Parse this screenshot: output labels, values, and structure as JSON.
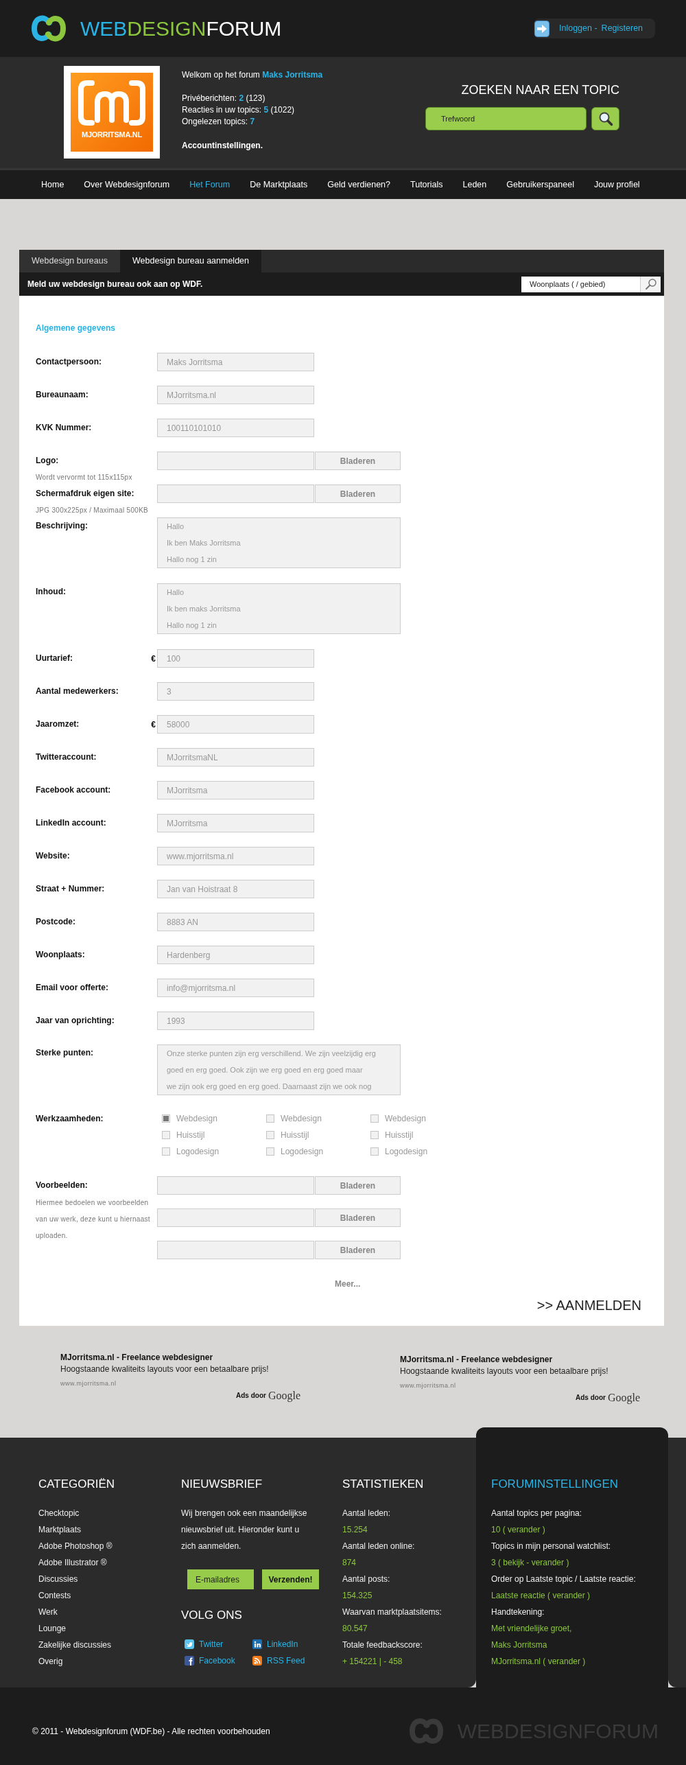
{
  "header": {
    "logo_parts": [
      "WEB",
      "DESIGN",
      "FORUM"
    ],
    "login_link": "Inloggen -",
    "register_link": "Registeren"
  },
  "user_panel": {
    "avatar_caption": "MJORRITSMA.NL",
    "welcome": "Welkom op het forum **Maks Jorritsma**",
    "stats": [
      "Privéberichten: **2** (123)",
      "Reacties in uw topics: **5** (1022)",
      "Ongelezen topics: **7**"
    ],
    "account_link": "Accountinstellingen."
  },
  "topic_search": {
    "title": "ZOEKEN NAAR EEN TOPIC",
    "placeholder": "Trefwoord"
  },
  "nav": [
    {
      "label": "Home",
      "selected": false
    },
    {
      "label": "Over Webdesignforum",
      "selected": false
    },
    {
      "label": "Het Forum",
      "selected": true
    },
    {
      "label": "De Marktplaats",
      "selected": false
    },
    {
      "label": "Geld verdienen?",
      "selected": false
    },
    {
      "label": "Tutorials",
      "selected": false
    },
    {
      "label": "Leden",
      "selected": false
    },
    {
      "label": "Gebruikerspaneel",
      "selected": false
    },
    {
      "label": "Jouw profiel",
      "selected": false
    }
  ],
  "panel": {
    "tabs": [
      {
        "label": "Webdesign bureaus",
        "selected": false
      },
      {
        "label": "Webdesign bureau aanmelden",
        "selected": true
      }
    ],
    "subtitle": "Meld uw webdesign bureau ook aan op WDF.",
    "location_search": {
      "placeholder": "Woonplaats ( / gebied)"
    }
  },
  "form": {
    "section_title": "Algemene gegevens",
    "fields": [
      {
        "kind": "text",
        "label": "Contactpersoon:",
        "value": "Maks Jorritsma"
      },
      {
        "kind": "text",
        "label": "Bureaunaam:",
        "value": "MJorritsma.nl"
      },
      {
        "kind": "text",
        "label": "KVK Nummer:",
        "value": "100110101010"
      },
      {
        "kind": "file",
        "label": "Logo:",
        "hint": "Wordt vervormt tot 115x115px",
        "button": "Bladeren"
      },
      {
        "kind": "file",
        "label": "Schermafdruk eigen site:",
        "hint": "JPG 300x225px / Maximaal 500KB",
        "button": "Bladeren"
      },
      {
        "kind": "textarea",
        "label": "Beschrijving:",
        "value": "Hallo\nIk ben Maks Jorritsma\nHallo nog 1 zin"
      },
      {
        "kind": "textarea",
        "label": "Inhoud:",
        "value": "Hallo\nIk ben maks Jorritsma\nHallo nog 1 zin"
      },
      {
        "kind": "text",
        "label": "Uurtarief:",
        "prefix": "€",
        "value": "100"
      },
      {
        "kind": "text",
        "label": "Aantal medewerkers:",
        "value": "3"
      },
      {
        "kind": "text",
        "label": "Jaaromzet:",
        "prefix": "€",
        "value": "58000"
      },
      {
        "kind": "text",
        "label": "Twitteraccount:",
        "value": "MJorritsmaNL"
      },
      {
        "kind": "text",
        "label": "Facebook account:",
        "value": "MJorritsma"
      },
      {
        "kind": "text",
        "label": "LinkedIn account:",
        "value": "MJorritsma"
      },
      {
        "kind": "text",
        "label": "Website:",
        "value": "www.mjorritsma.nl"
      },
      {
        "kind": "text",
        "label": "Straat + Nummer:",
        "value": "Jan van Hoistraat 8"
      },
      {
        "kind": "text",
        "label": "Postcode:",
        "value": "8883 AN"
      },
      {
        "kind": "text",
        "label": "Woonplaats:",
        "value": "Hardenberg"
      },
      {
        "kind": "text",
        "label": "Email voor offerte:",
        "value": "info@mjorritsma.nl"
      },
      {
        "kind": "text",
        "label": "Jaar van oprichting:",
        "value": "1993"
      },
      {
        "kind": "textarea",
        "label": "Sterke punten:",
        "value": "Onze sterke punten zijn erg verschillend. We zijn veelzijdig erg\ngoed en erg goed. Ook zijn we erg goed en erg goed maar\nwe zijn ook erg goed en erg goed. Daarnaast zijn we ook nog"
      },
      {
        "kind": "checkboxes",
        "label": "Werkzaamheden:",
        "columns": [
          {
            "options": [
              {
                "label": "Webdesign",
                "checked": true
              },
              {
                "label": "Huisstijl",
                "checked": false
              },
              {
                "label": "Logodesign",
                "checked": false
              }
            ]
          },
          {
            "options": [
              {
                "label": "Webdesign",
                "checked": false
              },
              {
                "label": "Huisstijl",
                "checked": false
              },
              {
                "label": "Logodesign",
                "checked": false
              }
            ]
          },
          {
            "options": [
              {
                "label": "Webdesign",
                "checked": false
              },
              {
                "label": "Huisstijl",
                "checked": false
              },
              {
                "label": "Logodesign",
                "checked": false
              }
            ]
          }
        ]
      },
      {
        "kind": "files",
        "label": "Voorbeelden:",
        "hint": "Hiermee bedoelen we voorbeelden van uw werk, deze kunt u hiernaast uploaden.",
        "buttons": [
          "Bladeren",
          "Bladeren",
          "Bladeren"
        ]
      }
    ],
    "more_link": "Meer...",
    "submit": ">> AANMELDEN"
  },
  "ads": [
    {
      "title": "MJorritsma.nl - Freelance webdesigner",
      "text": "Hoogstaande kwaliteits layouts voor een betaalbare prijs!",
      "url": "www.mjorritsma.nl",
      "attribution": "Ads door",
      "provider": "Google"
    },
    {
      "title": "MJorritsma.nl - Freelance webdesigner",
      "text": "Hoogstaande kwaliteits layouts voor een betaalbare prijs!",
      "url": "www.mjorritsma.nl",
      "attribution": "Ads door",
      "provider": "Google"
    }
  ],
  "footer": {
    "categories": {
      "title": "CATEGORIËN",
      "items": [
        "Checktopic",
        "Marktplaats",
        "Adobe Photoshop ®",
        "Adobe Illustrator ®",
        "Discussies",
        "Contests",
        "Werk",
        "Lounge",
        "Zakelijke discussies",
        "Overig"
      ]
    },
    "newsletter": {
      "title": "NIEUWSBRIEF",
      "text": "Wij brengen ook een maandelijkse nieuwsbrief uit. Hieronder kunt u zich aanmelden.",
      "email_placeholder": "E-mailadres",
      "submit": "Verzenden!"
    },
    "follow": {
      "title": "VOLG ONS",
      "links": [
        {
          "kind": "twitter",
          "label": "Twitter"
        },
        {
          "kind": "linkedin",
          "label": "LinkedIn"
        },
        {
          "kind": "facebook",
          "label": "Facebook"
        },
        {
          "kind": "rss",
          "label": "RSS Feed"
        }
      ]
    },
    "statistics": {
      "title": "STATISTIEKEN",
      "lines": [
        {
          "kind": "label",
          "text": "Aantal leden:"
        },
        {
          "kind": "value",
          "text": "15.254"
        },
        {
          "kind": "label",
          "text": "Aantal leden online:"
        },
        {
          "kind": "value",
          "text": "874"
        },
        {
          "kind": "label",
          "text": "Aantal posts:"
        },
        {
          "kind": "value",
          "text": "154.325"
        },
        {
          "kind": "label",
          "text": "Waarvan marktplaatsitems:"
        },
        {
          "kind": "value",
          "text": "80.547"
        },
        {
          "kind": "label",
          "text": "Totale feedbackscore:"
        },
        {
          "kind": "value",
          "text": "+ 154221 | - 458"
        }
      ]
    },
    "forum_settings": {
      "title": "FORUMINSTELLINGEN",
      "lines": [
        {
          "kind": "label",
          "text": "Aantal topics per pagina:"
        },
        {
          "kind": "value",
          "text": "10 ( verander )"
        },
        {
          "kind": "label",
          "text": "Topics in mijn personal watchlist:"
        },
        {
          "kind": "value",
          "text": "3 ( bekijk - verander )"
        },
        {
          "kind": "label",
          "text": "Order op Laatste topic / Laatste reactie:"
        },
        {
          "kind": "value",
          "text": "Laatste reactie ( verander )"
        },
        {
          "kind": "label",
          "text": "Handtekening:"
        },
        {
          "kind": "value",
          "text": "Met vriendelijke groet,"
        },
        {
          "kind": "value",
          "text": "Maks Jorritsma"
        },
        {
          "kind": "value",
          "text": "MJorritsma.nl ( verander )"
        }
      ]
    }
  },
  "bottom_bar": {
    "copyright": "© 2011 - Webdesignforum (WDF.be) - Alle rechten voorbehouden",
    "logo_text": "WEBDESIGNFORUM"
  }
}
